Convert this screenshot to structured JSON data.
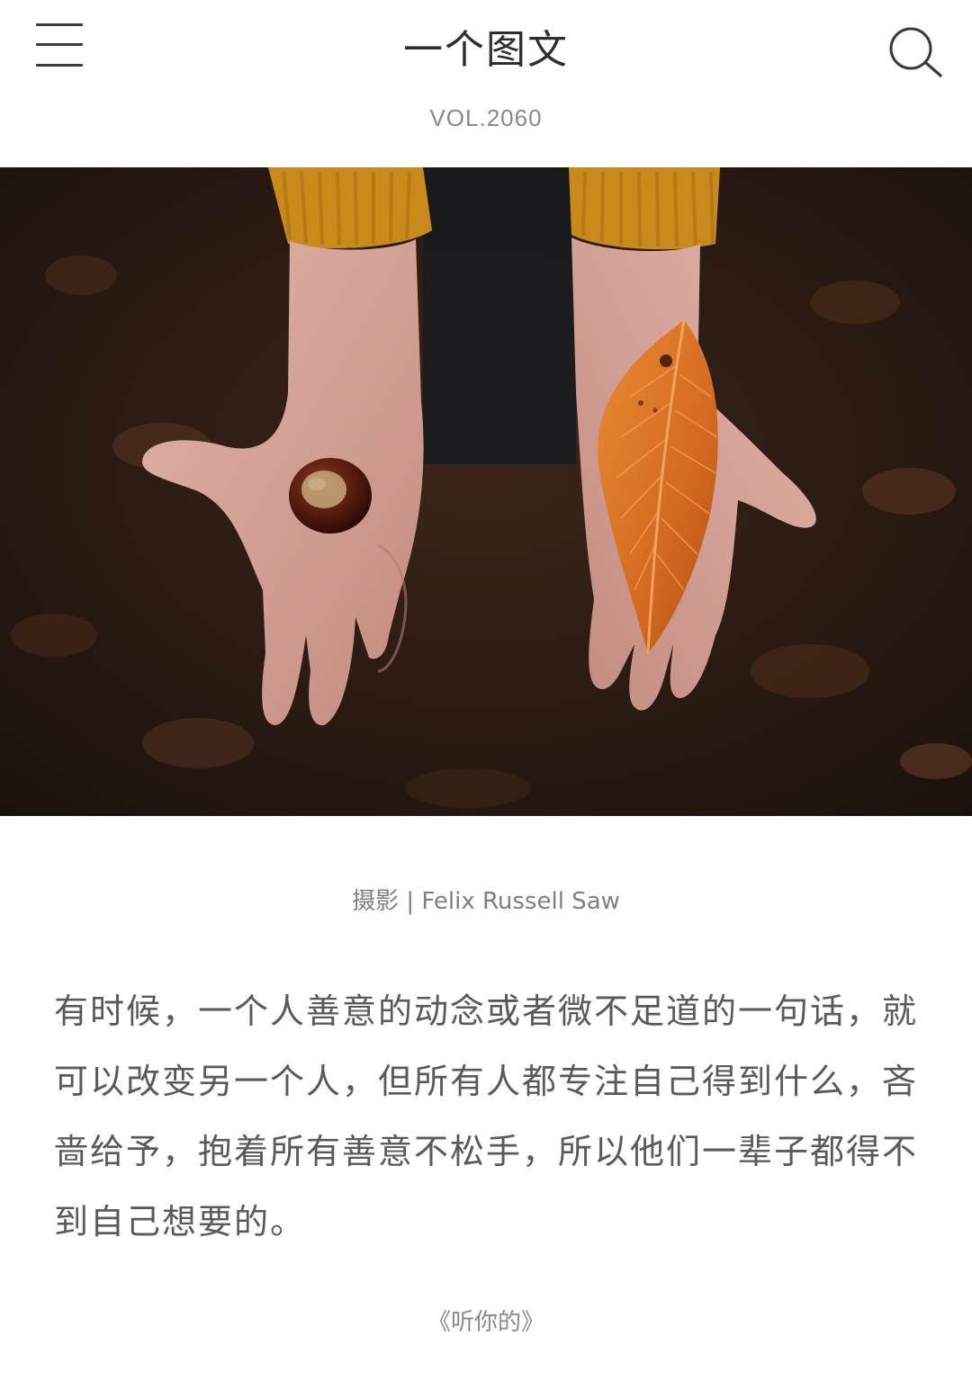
{
  "header": {
    "title": "一个图文",
    "volume": "VOL.2060",
    "menu_icon": "hamburger-menu-icon",
    "search_icon": "search-icon"
  },
  "photo": {
    "alt": "",
    "colors": {
      "background": "#2a1c14",
      "sweater": "#c98a1c",
      "skin": "#d6a59a",
      "leaf": "#d9782a",
      "chestnut": "#5e1f12"
    }
  },
  "credit": "摄影 | Felix Russell Saw",
  "content": {
    "text": "有时候，一个人善意的动念或者微不足道的一句话，就可以改变另一个人，但所有人都专注自己得到什么，吝啬给予，抱着所有善意不松手，所以他们一辈子都得不到自己想要的。"
  },
  "source": "《听你的》"
}
